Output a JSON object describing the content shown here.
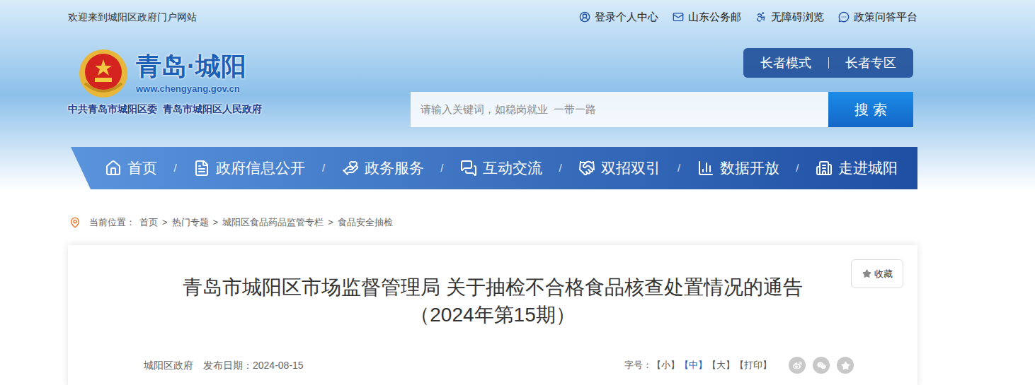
{
  "topbar": {
    "welcome": "欢迎来到城阳区政府门户网站",
    "links": [
      {
        "label": "登录个人中心"
      },
      {
        "label": "山东公务邮"
      },
      {
        "label": "无障碍浏览"
      },
      {
        "label": "政策问答平台"
      }
    ]
  },
  "logo": {
    "title": "青岛·城阳",
    "url": "www.chengyang.gov.cn",
    "subtitle": "中共青岛市城阳区委  青岛市城阳区人民政府"
  },
  "elder": [
    "长者模式",
    "长者专区"
  ],
  "search": {
    "placeholder": "请输入关键词，如稳岗就业  一带一路",
    "button": "搜 索"
  },
  "nav": {
    "separator": "/",
    "items": [
      {
        "label": "首页"
      },
      {
        "label": "政府信息公开"
      },
      {
        "label": "政务服务"
      },
      {
        "label": "互动交流"
      },
      {
        "label": "双招双引"
      },
      {
        "label": "数据开放"
      },
      {
        "label": "走进城阳"
      }
    ]
  },
  "breadcrumb": {
    "label": "当前位置：",
    "separator": ">",
    "items": [
      "首页",
      "热门专题",
      "城阳区食品药品监管专栏",
      "食品安全抽检"
    ]
  },
  "article": {
    "title": "青岛市城阳区市场监督管理局 关于抽检不合格食品核查处置情况的通告（2024年第15期）",
    "collect": "收藏",
    "source": "城阳区政府",
    "date": "发布日期：2024-08-15",
    "font_size_label": "字号：",
    "font_sizes": [
      {
        "label": "【小】",
        "selected": false
      },
      {
        "label": "【中】",
        "selected": true
      },
      {
        "label": "【大】",
        "selected": false
      }
    ],
    "print": "【打印】"
  }
}
